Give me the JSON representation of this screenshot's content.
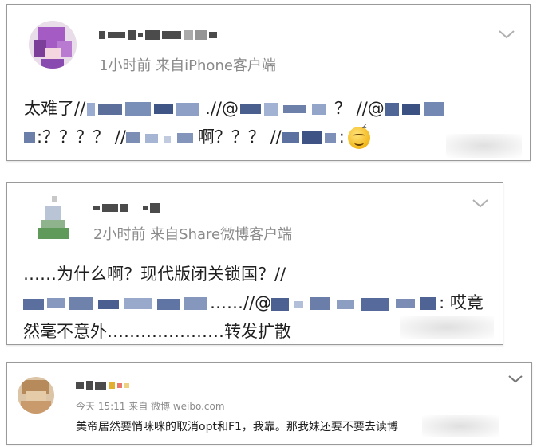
{
  "posts": [
    {
      "meta": "1小时前  来自iPhone客户端",
      "line1_a": "太难了//",
      "line1_b": ".//@",
      "line1_c": "？ //@",
      "line2_a": ":？？？？ //",
      "line2_b": "啊？？？ //",
      "line2_c": ":"
    },
    {
      "meta": "2小时前  来自Share微博客户端",
      "line1": "……为什么啊？现代版闭关锁国？//",
      "line2_a": "……//@",
      "line2_b": ": 哎竟",
      "line3": "然毫不意外…………………转发扩散"
    },
    {
      "meta": "今天 15:11 来自 微博 weibo.com",
      "line1": "美帝居然要悄咪咪的取消opt和F1，我靠。那我妹还要不要去读博"
    }
  ],
  "icons": {
    "menu": "chevron-down-icon",
    "emoji": "sleepy-smile-emoji-icon"
  },
  "colors": {
    "card_border": "#9a9a9a",
    "meta_text": "#8a8a8a",
    "body_text": "#1f1f1f",
    "avatar1": "#a45bc4",
    "avatar2": "#6aa066",
    "avatar3": "#c99a6b"
  }
}
